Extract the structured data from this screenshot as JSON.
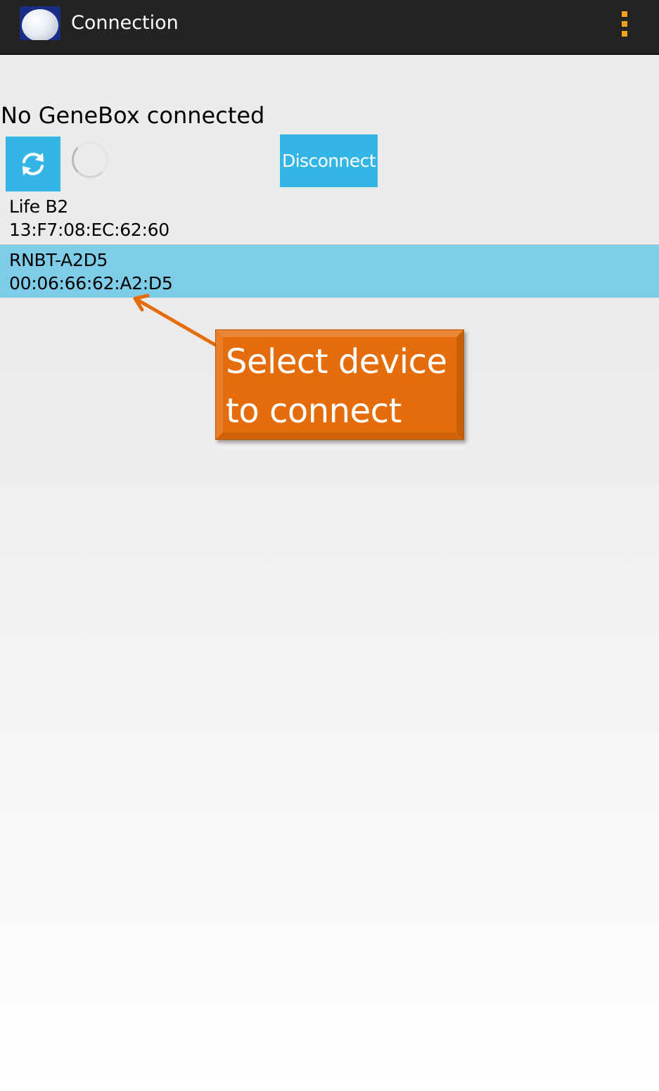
{
  "action_bar": {
    "title": "Connection",
    "app_icon": "app-logo-icon",
    "menu_icon": "overflow-menu-icon",
    "background_color": "#232323",
    "menu_color": "#f0a21d"
  },
  "connection": {
    "status": "No GeneBox connected",
    "refresh_icon": "refresh-icon",
    "disconnect_label": "Disconnect",
    "button_color": "#33b5e5"
  },
  "devices": [
    {
      "name": "Life B2",
      "address": "13:F7:08:EC:62:60",
      "selected": false
    },
    {
      "name": "RNBT-A2D5",
      "address": "00:06:66:62:A2:D5",
      "selected": true
    }
  ],
  "selected_color": "#7ecce8",
  "callout": {
    "text": "Select device to connect",
    "color": "#e46c0a"
  }
}
